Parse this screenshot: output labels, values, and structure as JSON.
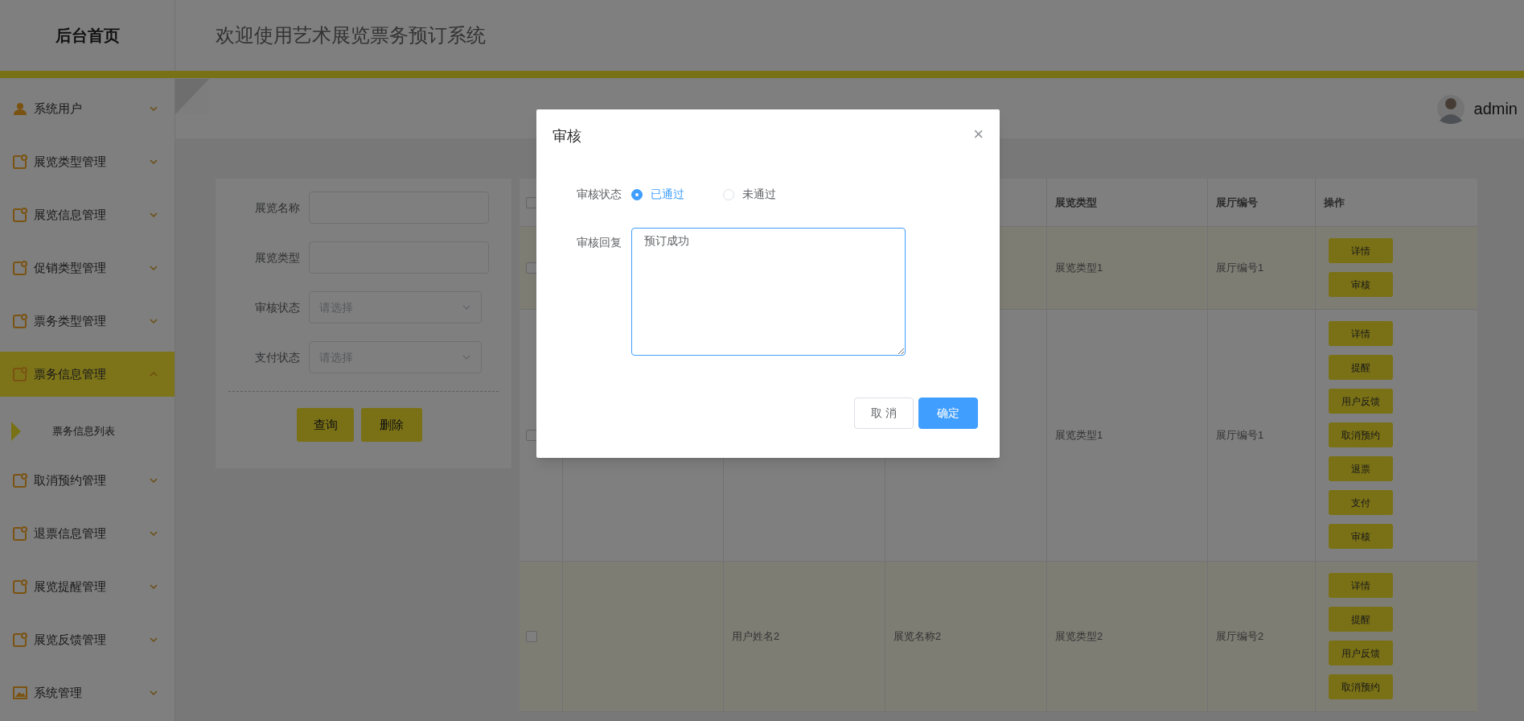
{
  "header": {
    "brand": "后台首页",
    "title": "欢迎使用艺术展览票务预订系统"
  },
  "user": {
    "name": "admin"
  },
  "sidebar": {
    "items": [
      {
        "label": "系统用户",
        "expanded": false,
        "selected": false
      },
      {
        "label": "展览类型管理",
        "expanded": false,
        "selected": false
      },
      {
        "label": "展览信息管理",
        "expanded": false,
        "selected": false
      },
      {
        "label": "促销类型管理",
        "expanded": false,
        "selected": false
      },
      {
        "label": "票务类型管理",
        "expanded": false,
        "selected": false
      },
      {
        "label": "票务信息管理",
        "expanded": true,
        "selected": true,
        "children": [
          {
            "label": "票务信息列表",
            "selected": true
          }
        ]
      },
      {
        "label": "取消预约管理",
        "expanded": false,
        "selected": false
      },
      {
        "label": "退票信息管理",
        "expanded": false,
        "selected": false
      },
      {
        "label": "展览提醒管理",
        "expanded": false,
        "selected": false
      },
      {
        "label": "展览反馈管理",
        "expanded": false,
        "selected": false
      },
      {
        "label": "系统管理",
        "expanded": false,
        "selected": false
      }
    ]
  },
  "filter": {
    "fields": [
      {
        "kind": "text",
        "label": "展览名称"
      },
      {
        "kind": "text",
        "label": "展览类型"
      },
      {
        "kind": "select",
        "label": "审核状态",
        "placeholder": "请选择"
      },
      {
        "kind": "select",
        "label": "支付状态",
        "placeholder": "请选择"
      }
    ],
    "buttons": [
      "查询",
      "删除"
    ]
  },
  "table": {
    "all_checked": false,
    "headers": {
      "column_4": "展览类型",
      "column_5": "展厅编号",
      "actions": "操作"
    },
    "rows": [
      {
        "checked": false,
        "column_4": "展览类型1",
        "column_5": "展厅编号1",
        "actions": [
          "详情",
          "审核"
        ]
      },
      {
        "checked": false,
        "column_4": "展览类型1",
        "column_5": "展厅编号1",
        "actions": [
          "详情",
          "提醒",
          "用户反馈",
          "取消预约",
          "退票",
          "支付",
          "审核"
        ]
      },
      {
        "checked": false,
        "column_2": "用户姓名2",
        "column_3": "展览名称2",
        "column_4": "展览类型2",
        "column_5": "展厅编号2",
        "actions": [
          "详情",
          "提醒",
          "用户反馈",
          "取消预约"
        ]
      }
    ]
  },
  "dialog": {
    "title": "审核",
    "close": "×",
    "status": {
      "label": "审核状态",
      "options": [
        {
          "label": "已通过",
          "selected": true
        },
        {
          "label": "未通过",
          "selected": false
        }
      ]
    },
    "reply": {
      "label": "审核回复",
      "value": "预订成功"
    },
    "buttons": [
      {
        "label": "取 消",
        "kind": "default"
      },
      {
        "label": "确定",
        "kind": "primary"
      }
    ]
  }
}
